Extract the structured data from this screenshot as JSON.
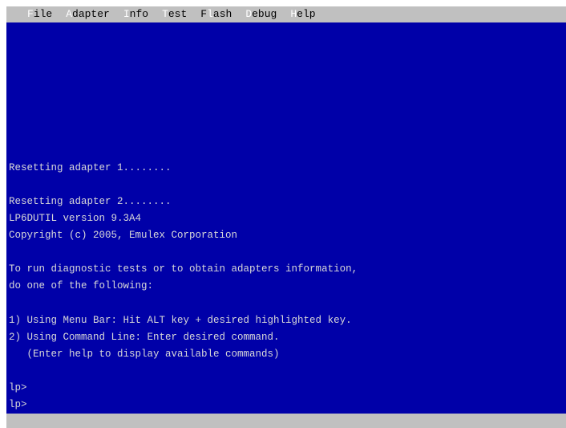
{
  "menu": {
    "items": [
      {
        "hotkey": "F",
        "rest": "ile"
      },
      {
        "hotkey": "A",
        "rest": "dapter"
      },
      {
        "hotkey": "I",
        "rest": "nfo"
      },
      {
        "hotkey": "T",
        "rest": "est"
      },
      {
        "hotkey": "F",
        "pre": "F",
        "rest": "ash",
        "hotkey_mid": "l"
      },
      {
        "hotkey": "D",
        "rest": "ebug"
      },
      {
        "hotkey": "H",
        "rest": "elp"
      }
    ]
  },
  "console": {
    "lines": [
      "Resetting adapter 1........",
      "Resetting adapter 2........",
      "LP6DUTIL version 9.3A4",
      "Copyright (c) 2005, Emulex Corporation",
      "To run diagnostic tests or to obtain adapters information,",
      "do one of the following:",
      "1) Using Menu Bar: Hit ALT key + desired highlighted key.",
      "2) Using Command Line: Enter desired command.",
      "   (Enter help to display available commands)",
      "lp>",
      "lp>"
    ]
  },
  "colors": {
    "console_bg": "#0000a8",
    "menubar_bg": "#c0c0c0",
    "text": "#d8d8d8",
    "hotkey": "#ffffff"
  }
}
